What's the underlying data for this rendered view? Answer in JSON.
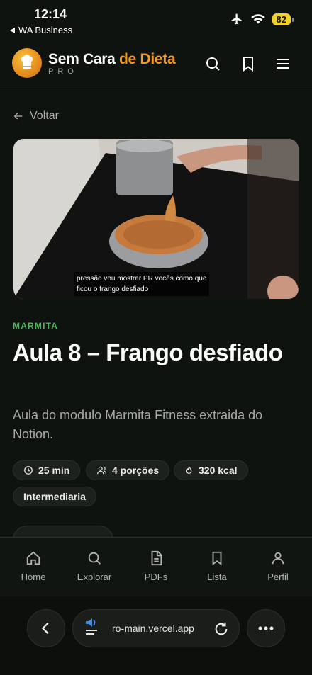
{
  "status": {
    "time": "12:14",
    "back_app": "WA Business",
    "battery": "82"
  },
  "header": {
    "brand_part1": "Sem Cara ",
    "brand_part2": "de Dieta",
    "brand_sub": "PRO"
  },
  "back_label": "Voltar",
  "video": {
    "caption_line1": "pressão vou mostrar PR vocês como que",
    "caption_line2": "ficou o frango desfiado"
  },
  "lesson": {
    "category": "MARMITA",
    "title": "Aula 8 – Frango desfiado",
    "description": "Aula do modulo Marmita Fitness extraida do Notion."
  },
  "chips": {
    "time": "25 min",
    "portions": "4 porções",
    "calories": "320 kcal",
    "level": "Intermediaria"
  },
  "nav": {
    "home": "Home",
    "explore": "Explorar",
    "pdfs": "PDFs",
    "list": "Lista",
    "profile": "Perfil"
  },
  "browser": {
    "url": "ro-main.vercel.app"
  },
  "colors": {
    "accent_green": "#4fb35a",
    "brand_orange": "#f39a1f",
    "background": "#0f130f"
  }
}
